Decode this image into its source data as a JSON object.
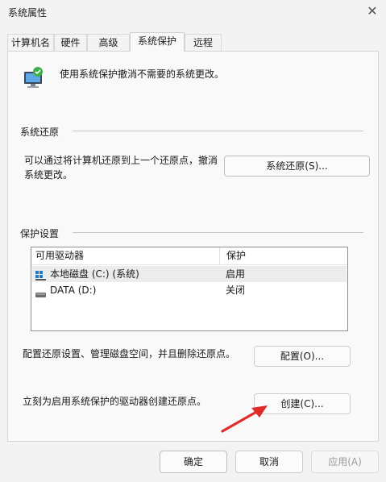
{
  "window": {
    "title": "系统属性"
  },
  "tabs": [
    {
      "label": "计算机名"
    },
    {
      "label": "硬件"
    },
    {
      "label": "高级"
    },
    {
      "label": "系统保护"
    },
    {
      "label": "远程"
    }
  ],
  "intro": {
    "text": "使用系统保护撤消不需要的系统更改。"
  },
  "restore": {
    "heading": "系统还原",
    "description": "可以通过将计算机还原到上一个还原点，撤消系统更改。",
    "button": "系统还原(S)..."
  },
  "protection": {
    "heading": "保护设置",
    "columns": [
      "可用驱动器",
      "保护"
    ],
    "drives": [
      {
        "name": "本地磁盘 (C:) (系统)",
        "status": "启用"
      },
      {
        "name": "DATA (D:)",
        "status": "关闭"
      }
    ],
    "configure_text": "配置还原设置、管理磁盘空间，并且删除还原点。",
    "configure_button": "配置(O)...",
    "create_text": "立刻为启用系统保护的驱动器创建还原点。",
    "create_button": "创建(C)..."
  },
  "footer": {
    "ok": "确定",
    "cancel": "取消",
    "apply": "应用(A)"
  },
  "colors": {
    "annotation_arrow": "#e02b2b",
    "dialog_bg": "#f3f3f3",
    "panel_bg": "#f9f9f9"
  }
}
